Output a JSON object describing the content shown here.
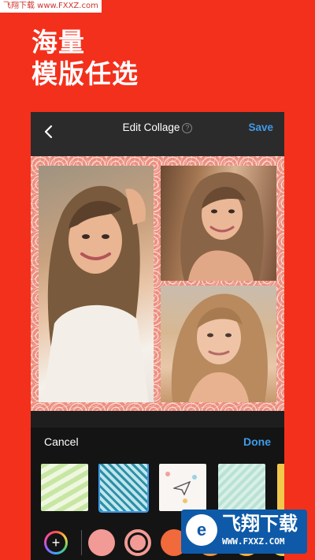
{
  "watermark_top": "飞翔下载 www.FXXZ.com",
  "headline": {
    "line1": "海量",
    "line2": "模版任选"
  },
  "navbar": {
    "title": "Edit Collage",
    "help_glyph": "?",
    "save_label": "Save",
    "back_icon": "chevron-left-icon"
  },
  "collage": {
    "frame_pattern": "coral-swirl",
    "frame_color": "#ed8f7f",
    "photos": 3
  },
  "panel": {
    "cancel_label": "Cancel",
    "done_label": "Done",
    "backgrounds": [
      "green-wave",
      "teal-geometric",
      "white-doodle",
      "mint-stripe",
      "yellow"
    ],
    "selected_background": 1,
    "add_color_glyph": "+",
    "colors": [
      "#f29a95",
      "#f29a95",
      "#f06a3c",
      "#f0963c",
      "#f3b23c",
      "#f3c94b"
    ],
    "selected_color": 1
  },
  "watermark_bottom": {
    "logo_glyph": "e",
    "title": "飞翔下载",
    "url": "WWW.FXXZ.COM"
  }
}
